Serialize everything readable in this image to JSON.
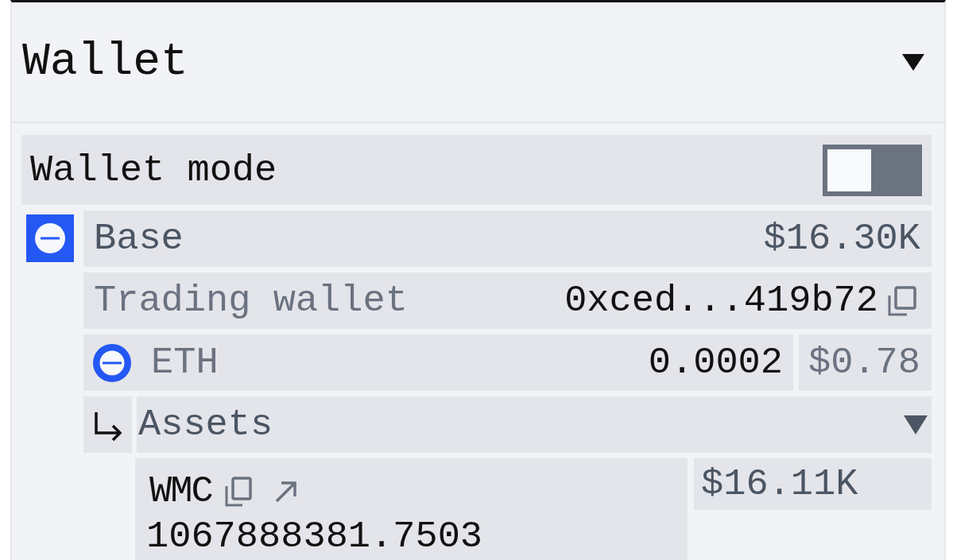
{
  "panel": {
    "title": "Wallet",
    "expanded": true,
    "wallet_mode": {
      "label": "Wallet mode",
      "on": false
    },
    "networks": [
      {
        "name": "Base",
        "balance": "$16.30K",
        "wallet": {
          "label": "Trading wallet",
          "address": "0xced...419b72"
        },
        "native_token": {
          "symbol": "ETH",
          "amount": "0.0002",
          "value": "$0.78"
        },
        "assets": {
          "label": "Assets",
          "expanded": true,
          "items": [
            {
              "symbol": "WMC",
              "amount": "1067888381.7503",
              "value": "$16.11K"
            }
          ]
        }
      }
    ]
  }
}
